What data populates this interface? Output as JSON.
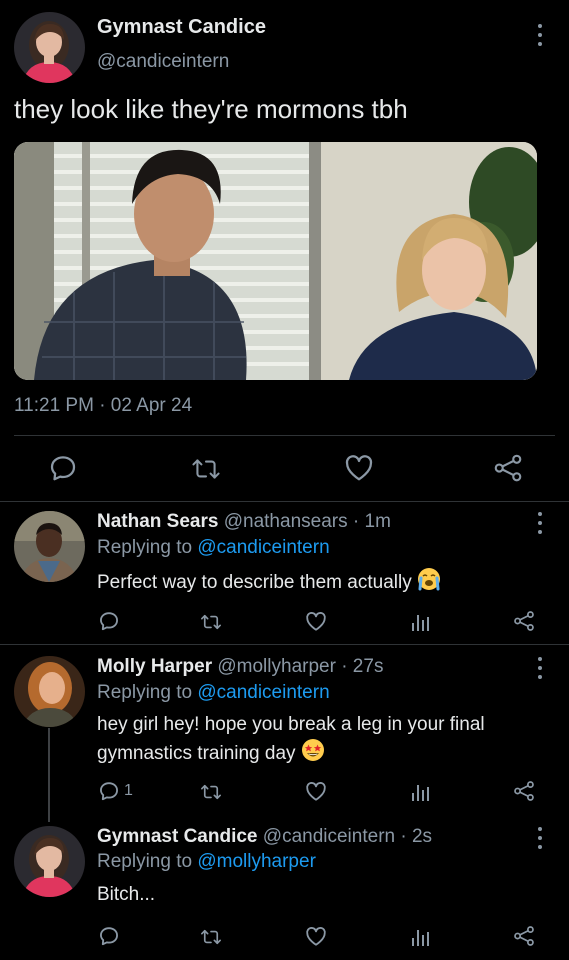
{
  "main_tweet": {
    "name": "Gymnast Candice",
    "handle": "@candiceintern",
    "text": "they look like they're mormons tbh",
    "timestamp": "11:21 PM · 02 Apr 24"
  },
  "replies": [
    {
      "name": "Nathan Sears",
      "handle": "@nathansears",
      "time": "· 1m",
      "replying_prefix": "Replying to",
      "replying_to": "@candiceintern",
      "text": "Perfect way to describe them actually",
      "emoji": "crying-face",
      "reply_count": ""
    },
    {
      "name": "Molly Harper",
      "handle": "@mollyharper",
      "time": "· 27s",
      "replying_prefix": "Replying to",
      "replying_to": "@candiceintern",
      "text_line1": "hey girl hey! hope you break a leg in your final",
      "text_line2": "gymnastics training day",
      "emoji": "star-struck-face",
      "reply_count": "1"
    },
    {
      "name": "Gymnast Candice",
      "handle": "@candiceintern",
      "time": "· 2s",
      "replying_prefix": "Replying to",
      "replying_to": "@mollyharper",
      "text": "Bitch...",
      "reply_count": ""
    }
  ],
  "colors": {
    "background": "#000000",
    "text": "#e7e9ea",
    "secondary": "#8b98a5",
    "link": "#1d9bf0",
    "divider": "#2f3336"
  }
}
